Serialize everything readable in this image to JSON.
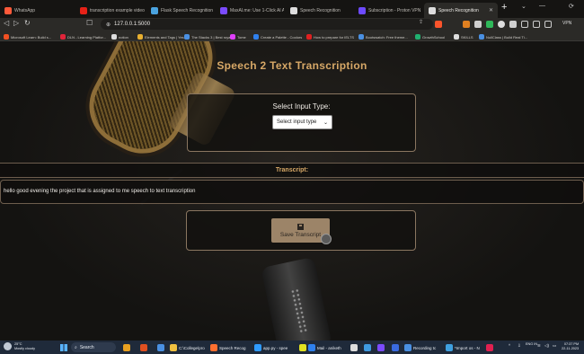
{
  "browser": {
    "tabs": [
      {
        "label": "WhatsApp",
        "color": "#ff5a3a"
      },
      {
        "label": "transcription example video - You",
        "color": "#e62117"
      },
      {
        "label": "Flask Speech Recognition App",
        "color": "#4aa3df"
      },
      {
        "label": "MaxAI.me: Use 1-Click AI Anywhere",
        "color": "#7b4bff"
      },
      {
        "label": "Speech Recognition",
        "color": "#dddddd"
      },
      {
        "label": "Subscription - Proton VPN",
        "color": "#6d4aff"
      },
      {
        "label": "Speech Recognition",
        "color": "#dddddd",
        "active": true
      }
    ],
    "url": "127.0.0.1:5000",
    "vpn_label": "VPN",
    "bookmarks": [
      {
        "label": "Microsoft Learn: Build s...",
        "color": "#f25022"
      },
      {
        "label": "DLN - Learning Platfor...",
        "color": "#e0243a"
      },
      {
        "label": "notion",
        "color": "#dddddd"
      },
      {
        "label": "Elements and Tags | Yes...",
        "color": "#e8b030"
      },
      {
        "label": "The Stacks 3 | Best royal...",
        "color": "#4a90e2"
      },
      {
        "label": "Tome",
        "color": "#e040fb"
      },
      {
        "label": "Create a Palette - Coolors",
        "color": "#2f80ed"
      },
      {
        "label": "How to prepare for IELTS",
        "color": "#e02020"
      },
      {
        "label": "Bootswatch: Free theme...",
        "color": "#4a90e2"
      },
      {
        "label": "GrowthSchool",
        "color": "#20b070"
      },
      {
        "label": "SKILLS",
        "color": "#dddddd"
      },
      {
        "label": "NullClass | Build Real Ti...",
        "color": "#4a90e2"
      }
    ]
  },
  "page": {
    "title": "Speech 2 Text Transcription",
    "select_label": "Select Input Type:",
    "select_value": "Select input type",
    "transcript_heading": "Transcript:",
    "transcript_text": "hello good evening the project that is assigned to me speech to text transcription",
    "save_button": "Save Transcript",
    "accent_color": "#d7a867"
  },
  "taskbar": {
    "weather_temp": "25°C",
    "weather_desc": "Mostly cloudy",
    "search_label": "Search",
    "apps": [
      {
        "label": "",
        "color": "#e8a020"
      },
      {
        "label": "",
        "color": "#e05020"
      },
      {
        "label": "",
        "color": "#4a90e2"
      },
      {
        "label": "C:\\College\\pro",
        "color": "#f0c040"
      },
      {
        "label": "Speech Recog",
        "color": "#ff7030"
      },
      {
        "label": "app.py - spee",
        "color": "#2f9bff"
      },
      {
        "label": "",
        "color": "#e0e020"
      },
      {
        "label": "Mail - aniketh",
        "color": "#2f80ed"
      },
      {
        "label": "",
        "color": "#dddddd"
      },
      {
        "label": "",
        "color": "#3f9ae0"
      },
      {
        "label": "",
        "color": "#7b4bff"
      },
      {
        "label": "",
        "color": "#3a6be0"
      },
      {
        "label": "Recording tc",
        "color": "#4a90e2"
      },
      {
        "label": "*Import os - N",
        "color": "#3fa0e0"
      },
      {
        "label": "",
        "color": "#e02050"
      }
    ],
    "lang": "ENG IN",
    "time": "07:37 PM",
    "date": "22-11-2023"
  }
}
